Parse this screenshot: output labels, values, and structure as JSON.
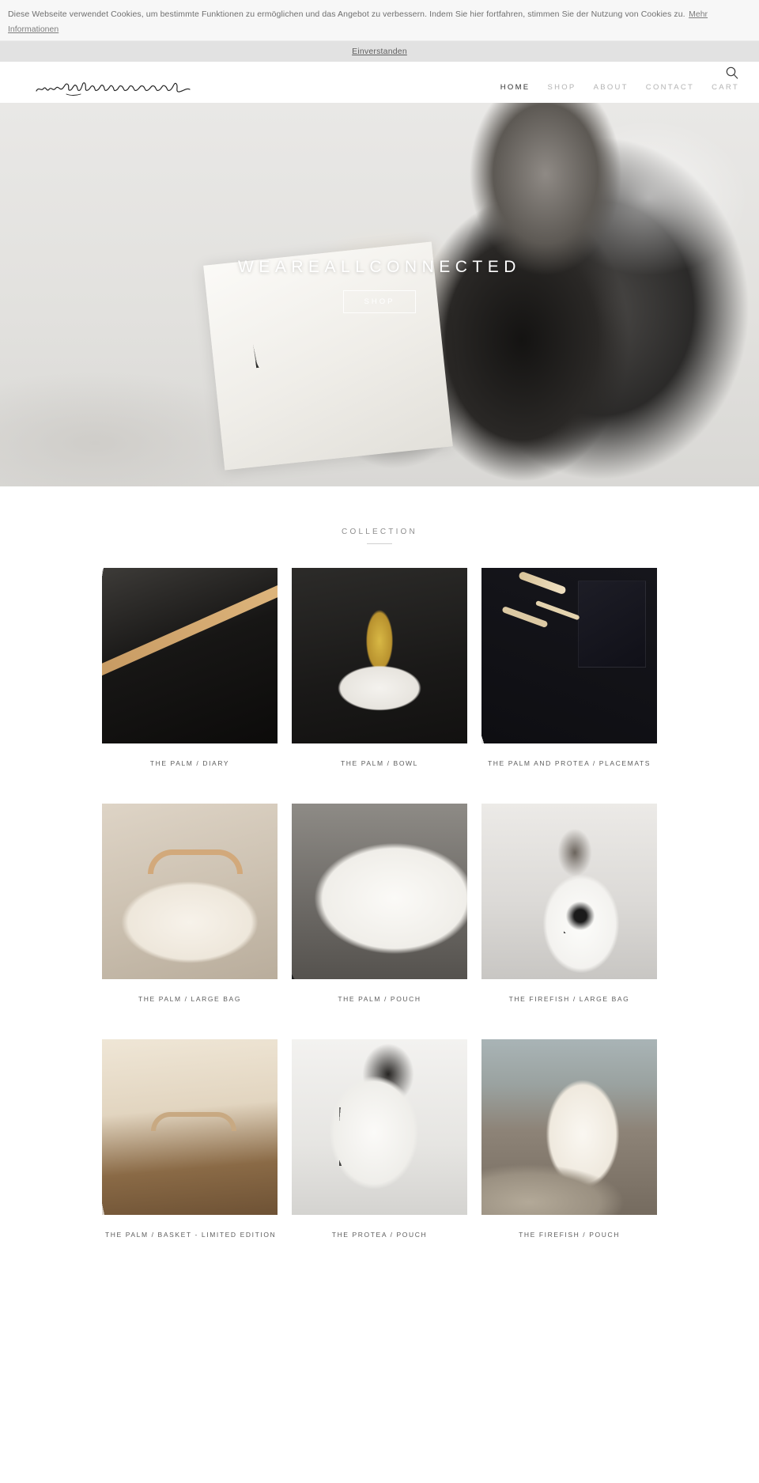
{
  "cookie": {
    "text": "Diese Webseite verwendet Cookies, um bestimmte Funktionen zu ermöglichen und das Angebot zu verbessern. Indem Sie hier fortfahren, stimmen Sie der Nutzung von Cookies zu.",
    "more_label": "Mehr Informationen",
    "accept_label": "Einverstanden"
  },
  "header": {
    "logo_text": "weareallconnected",
    "search_icon": "search-icon",
    "nav": [
      {
        "label": "HOME",
        "active": true
      },
      {
        "label": "SHOP",
        "active": false
      },
      {
        "label": "ABOUT",
        "active": false
      },
      {
        "label": "CONTACT",
        "active": false
      },
      {
        "label": "CART",
        "active": false
      }
    ]
  },
  "hero": {
    "title": "WEAREALLCONNECTED",
    "cta_label": "SHOP"
  },
  "collection": {
    "title": "COLLECTION",
    "products": [
      {
        "caption": "THE PALM / DIARY",
        "art": "t-diary"
      },
      {
        "caption": "THE PALM / BOWL",
        "art": "t-bowl"
      },
      {
        "caption": "THE PALM AND PROTEA / PLACEMATS",
        "art": "t-place"
      },
      {
        "caption": "THE PALM / LARGE BAG",
        "art": "t-largebag"
      },
      {
        "caption": "THE PALM / POUCH",
        "art": "t-pouch"
      },
      {
        "caption": "THE FIREFISH / LARGE BAG",
        "art": "t-ff-large"
      },
      {
        "caption": "THE PALM / BASKET - LIMITED EDITION",
        "art": "t-basket"
      },
      {
        "caption": "THE PROTEA / POUCH",
        "art": "t-protea"
      },
      {
        "caption": "THE FIREFISH / POUCH",
        "art": "t-ff-pouch"
      }
    ]
  },
  "colors": {
    "cookie_bg": "#f7f7f7",
    "accept_bg": "#e2e2e2",
    "nav_inactive": "#b3b3b3",
    "nav_active": "#2e2e2e",
    "caption": "#5d5d5d"
  }
}
